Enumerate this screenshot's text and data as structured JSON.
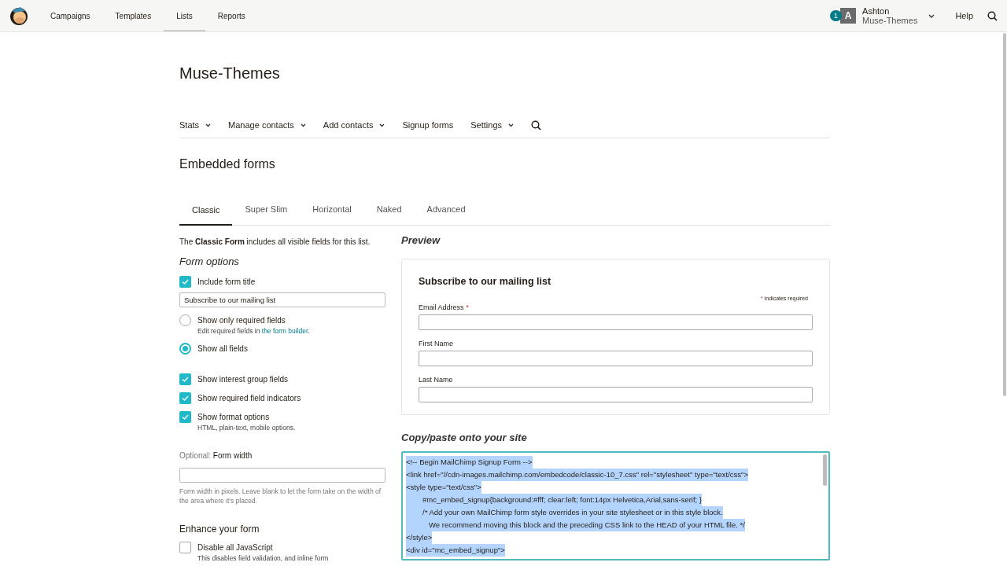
{
  "top_nav": {
    "items": [
      {
        "label": "Campaigns",
        "selected": false
      },
      {
        "label": "Templates",
        "selected": false
      },
      {
        "label": "Lists",
        "selected": true
      },
      {
        "label": "Reports",
        "selected": false
      }
    ],
    "notification_count": "1",
    "avatar_letter": "A",
    "user_name": "Ashton",
    "account_name": "Muse-Themes",
    "help": "Help"
  },
  "list_title": "Muse-Themes",
  "sub_nav": [
    {
      "label": "Stats",
      "dropdown": true
    },
    {
      "label": "Manage contacts",
      "dropdown": true
    },
    {
      "label": "Add contacts",
      "dropdown": true
    },
    {
      "label": "Signup forms",
      "dropdown": false
    },
    {
      "label": "Settings",
      "dropdown": true
    }
  ],
  "page_title": "Embedded forms",
  "tabs": [
    {
      "label": "Classic",
      "selected": true
    },
    {
      "label": "Super Slim",
      "selected": false
    },
    {
      "label": "Horizontal",
      "selected": false
    },
    {
      "label": "Naked",
      "selected": false
    },
    {
      "label": "Advanced",
      "selected": false
    }
  ],
  "intro": "The **Classic Form** includes all visible fields for this list.",
  "form_options": {
    "heading": "Form options",
    "items": [
      {
        "kind": "checkbox",
        "label": "Include form title",
        "checked": true
      },
      {
        "kind": "input",
        "value": "Subscribe to our mailing list"
      },
      {
        "kind": "radio",
        "label": "Show only required fields",
        "selected": false,
        "note": "Edit required fields in",
        "link": "the form builder",
        "note_end": "."
      },
      {
        "kind": "radio",
        "label": "Show all fields",
        "selected": true
      },
      {
        "kind": "checkbox",
        "label": "Show interest group fields",
        "checked": true
      },
      {
        "kind": "checkbox",
        "label": "Show required field indicators",
        "checked": true
      },
      {
        "kind": "checkbox",
        "label": "Show format options",
        "checked": true,
        "note": "HTML, plain-text, mobile options."
      }
    ]
  },
  "form_width": {
    "optional": "Optional:",
    "label": "Form width",
    "hint": "Form width in pixels. Leave blank to let the form take on the width of the area where it's placed."
  },
  "enhance": {
    "heading": "Enhance your form",
    "items": [
      {
        "label": "Disable all JavaScript",
        "checked": false,
        "note": "This disables field validation, and inline form"
      }
    ]
  },
  "preview": {
    "heading": "Preview",
    "form_title": "Subscribe to our mailing list",
    "required_mark": "*",
    "required_note": "indicates required",
    "fields": [
      {
        "label": "Email Address",
        "required": true
      },
      {
        "label": "First Name",
        "required": false
      },
      {
        "label": "Last Name",
        "required": false
      }
    ]
  },
  "code": {
    "heading": "Copy/paste onto your site",
    "selected": true,
    "lines": [
      {
        "kind": "plain",
        "text": "<!-- Begin MailChimp Signup Form -->"
      },
      {
        "kind": "plain",
        "text": "<link href=\"//cdn-images.mailchimp.com/embedcode/classic-10_7.css\" rel=\"stylesheet\" type=\"text/css\">"
      },
      {
        "kind": "plain",
        "text": "<style type=\"text/css\">"
      },
      {
        "kind": "indented",
        "text": "#mc_embed_signup{background:#fff; clear:left; font:14px Helvetica,Arial,sans-serif; }"
      },
      {
        "kind": "indented",
        "text": "/* Add your own MailChimp form style overrides in your site stylesheet or in this style block."
      },
      {
        "kind": "continued",
        "text": "We recommend moving this block and the preceding CSS link to the HEAD of your HTML file. */"
      },
      {
        "kind": "plain",
        "text": "</style>"
      },
      {
        "kind": "plain",
        "text": "<div id=\"mc_embed_signup\">"
      }
    ]
  }
}
